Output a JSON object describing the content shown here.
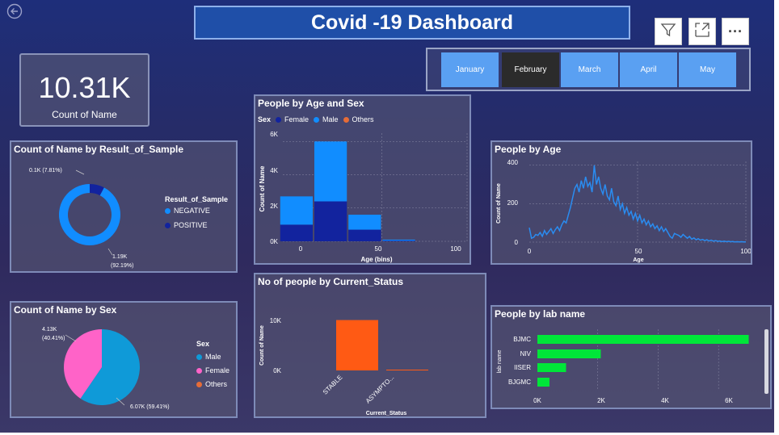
{
  "header": {
    "title": "Covid -19 Dashboard"
  },
  "toolbar": {
    "filter_icon": "filter-icon",
    "focus_icon": "focus-mode-icon",
    "more_icon": "more-options-icon",
    "more_label": "···",
    "back_icon": "back-arrow-icon"
  },
  "months": [
    {
      "label": "January",
      "selected": false
    },
    {
      "label": "February",
      "selected": true
    },
    {
      "label": "March",
      "selected": false
    },
    {
      "label": "April",
      "selected": false
    },
    {
      "label": "May",
      "selected": false
    }
  ],
  "kpi": {
    "value": "10.31K",
    "label": "Count of Name"
  },
  "colors": {
    "light_blue": "#118dff",
    "dark_blue": "#12239e",
    "orange": "#e66c37",
    "pink": "#ff63c8",
    "teal_blue": "#0f9ad8",
    "green": "#00e639",
    "status_orange": "#ff5a14",
    "line_blue": "#2a8cf0"
  },
  "result_chart": {
    "title": "Count of Name by Result_of_Sample",
    "legend_title": "Result_of_Sample",
    "chart_data": {
      "type": "pie",
      "categories": [
        "NEGATIVE",
        "POSITIVE"
      ],
      "values": [
        1190,
        100
      ],
      "label_negative_value": "1.19K",
      "label_negative_pct": "(92.19%)",
      "label_positive": "0.1K (7.81%)"
    }
  },
  "age_sex_chart": {
    "title": "People by Age and Sex",
    "legend_title": "Sex",
    "legend": [
      "Female",
      "Male",
      "Others"
    ],
    "ylabel": "Count of Name",
    "xlabel": "Age (bins)",
    "y_ticks": [
      "0K",
      "2K",
      "4K",
      "6K"
    ],
    "x_ticks": [
      "0",
      "50",
      "100"
    ],
    "chart_data": {
      "type": "bar",
      "x": [
        0,
        20,
        40,
        60,
        80
      ],
      "ylim": [
        0,
        6500
      ],
      "xlim": [
        -8,
        100
      ],
      "series": [
        {
          "name": "Female",
          "values": [
            1000,
            2400,
            700,
            40,
            0
          ]
        },
        {
          "name": "Male",
          "values": [
            1700,
            3600,
            900,
            60,
            0
          ]
        }
      ]
    }
  },
  "age_chart": {
    "title": "People by Age",
    "ylabel": "Count of Name",
    "xlabel": "Age",
    "y_ticks": [
      "0",
      "200",
      "400"
    ],
    "x_ticks": [
      "0",
      "50",
      "100"
    ],
    "chart_data": {
      "type": "line",
      "xlim": [
        0,
        100
      ],
      "ylim": [
        0,
        420
      ],
      "x": [
        0,
        1,
        2,
        3,
        4,
        5,
        6,
        7,
        8,
        9,
        10,
        11,
        12,
        13,
        14,
        15,
        16,
        17,
        18,
        19,
        20,
        21,
        22,
        23,
        24,
        25,
        26,
        27,
        28,
        29,
        30,
        31,
        32,
        33,
        34,
        35,
        36,
        37,
        38,
        39,
        40,
        41,
        42,
        43,
        44,
        45,
        46,
        47,
        48,
        49,
        50,
        51,
        52,
        53,
        54,
        55,
        56,
        57,
        58,
        59,
        60,
        61,
        62,
        63,
        64,
        65,
        66,
        67,
        68,
        69,
        70,
        71,
        72,
        73,
        74,
        75,
        76,
        77,
        78,
        79,
        80,
        81,
        82,
        83,
        84,
        85,
        86,
        87,
        88,
        89,
        90,
        91,
        92,
        93,
        94,
        95,
        96,
        97,
        98,
        99,
        100
      ],
      "y": [
        75,
        20,
        25,
        40,
        35,
        50,
        30,
        60,
        40,
        55,
        70,
        45,
        65,
        80,
        60,
        90,
        110,
        100,
        140,
        180,
        230,
        280,
        300,
        260,
        320,
        280,
        340,
        290,
        310,
        260,
        400,
        300,
        340,
        280,
        250,
        300,
        240,
        220,
        280,
        210,
        190,
        240,
        170,
        200,
        150,
        180,
        140,
        160,
        120,
        150,
        110,
        140,
        100,
        120,
        90,
        110,
        80,
        95,
        70,
        85,
        60,
        80,
        55,
        70,
        50,
        30,
        20,
        45,
        40,
        35,
        25,
        40,
        30,
        20,
        30,
        15,
        22,
        12,
        18,
        10,
        14,
        8,
        12,
        6,
        10,
        5,
        8,
        4,
        6,
        3,
        5,
        2,
        4,
        2,
        3,
        1,
        2,
        1,
        2,
        1,
        1
      ]
    }
  },
  "sex_chart": {
    "title": "Count of Name by Sex",
    "legend_title": "Sex",
    "chart_data": {
      "type": "pie",
      "categories": [
        "Male",
        "Female",
        "Others"
      ],
      "values": [
        6070,
        4130,
        0
      ],
      "label_male": "6.07K (59.41%)",
      "label_female_value": "4.13K",
      "label_female_pct": "(40.41%)"
    }
  },
  "status_chart": {
    "title": "No of people by Current_Status",
    "ylabel": "Count of Name",
    "xlabel": "Current_Status",
    "y_ticks": [
      "0K",
      "10K"
    ],
    "chart_data": {
      "type": "bar",
      "categories": [
        "STABLE",
        "ASYMPTO..."
      ],
      "values": [
        10100,
        150
      ],
      "ylim": [
        0,
        11000
      ]
    }
  },
  "lab_chart": {
    "title": "People by lab name",
    "ylabel": "lab name",
    "x_ticks": [
      "0K",
      "2K",
      "4K",
      "6K"
    ],
    "chart_data": {
      "type": "bar",
      "orientation": "horizontal",
      "categories": [
        "BJMC",
        "NIV",
        "IISER",
        "BJGMC"
      ],
      "values": [
        7000,
        2100,
        950,
        400
      ],
      "xlim": [
        0,
        7200
      ]
    }
  }
}
